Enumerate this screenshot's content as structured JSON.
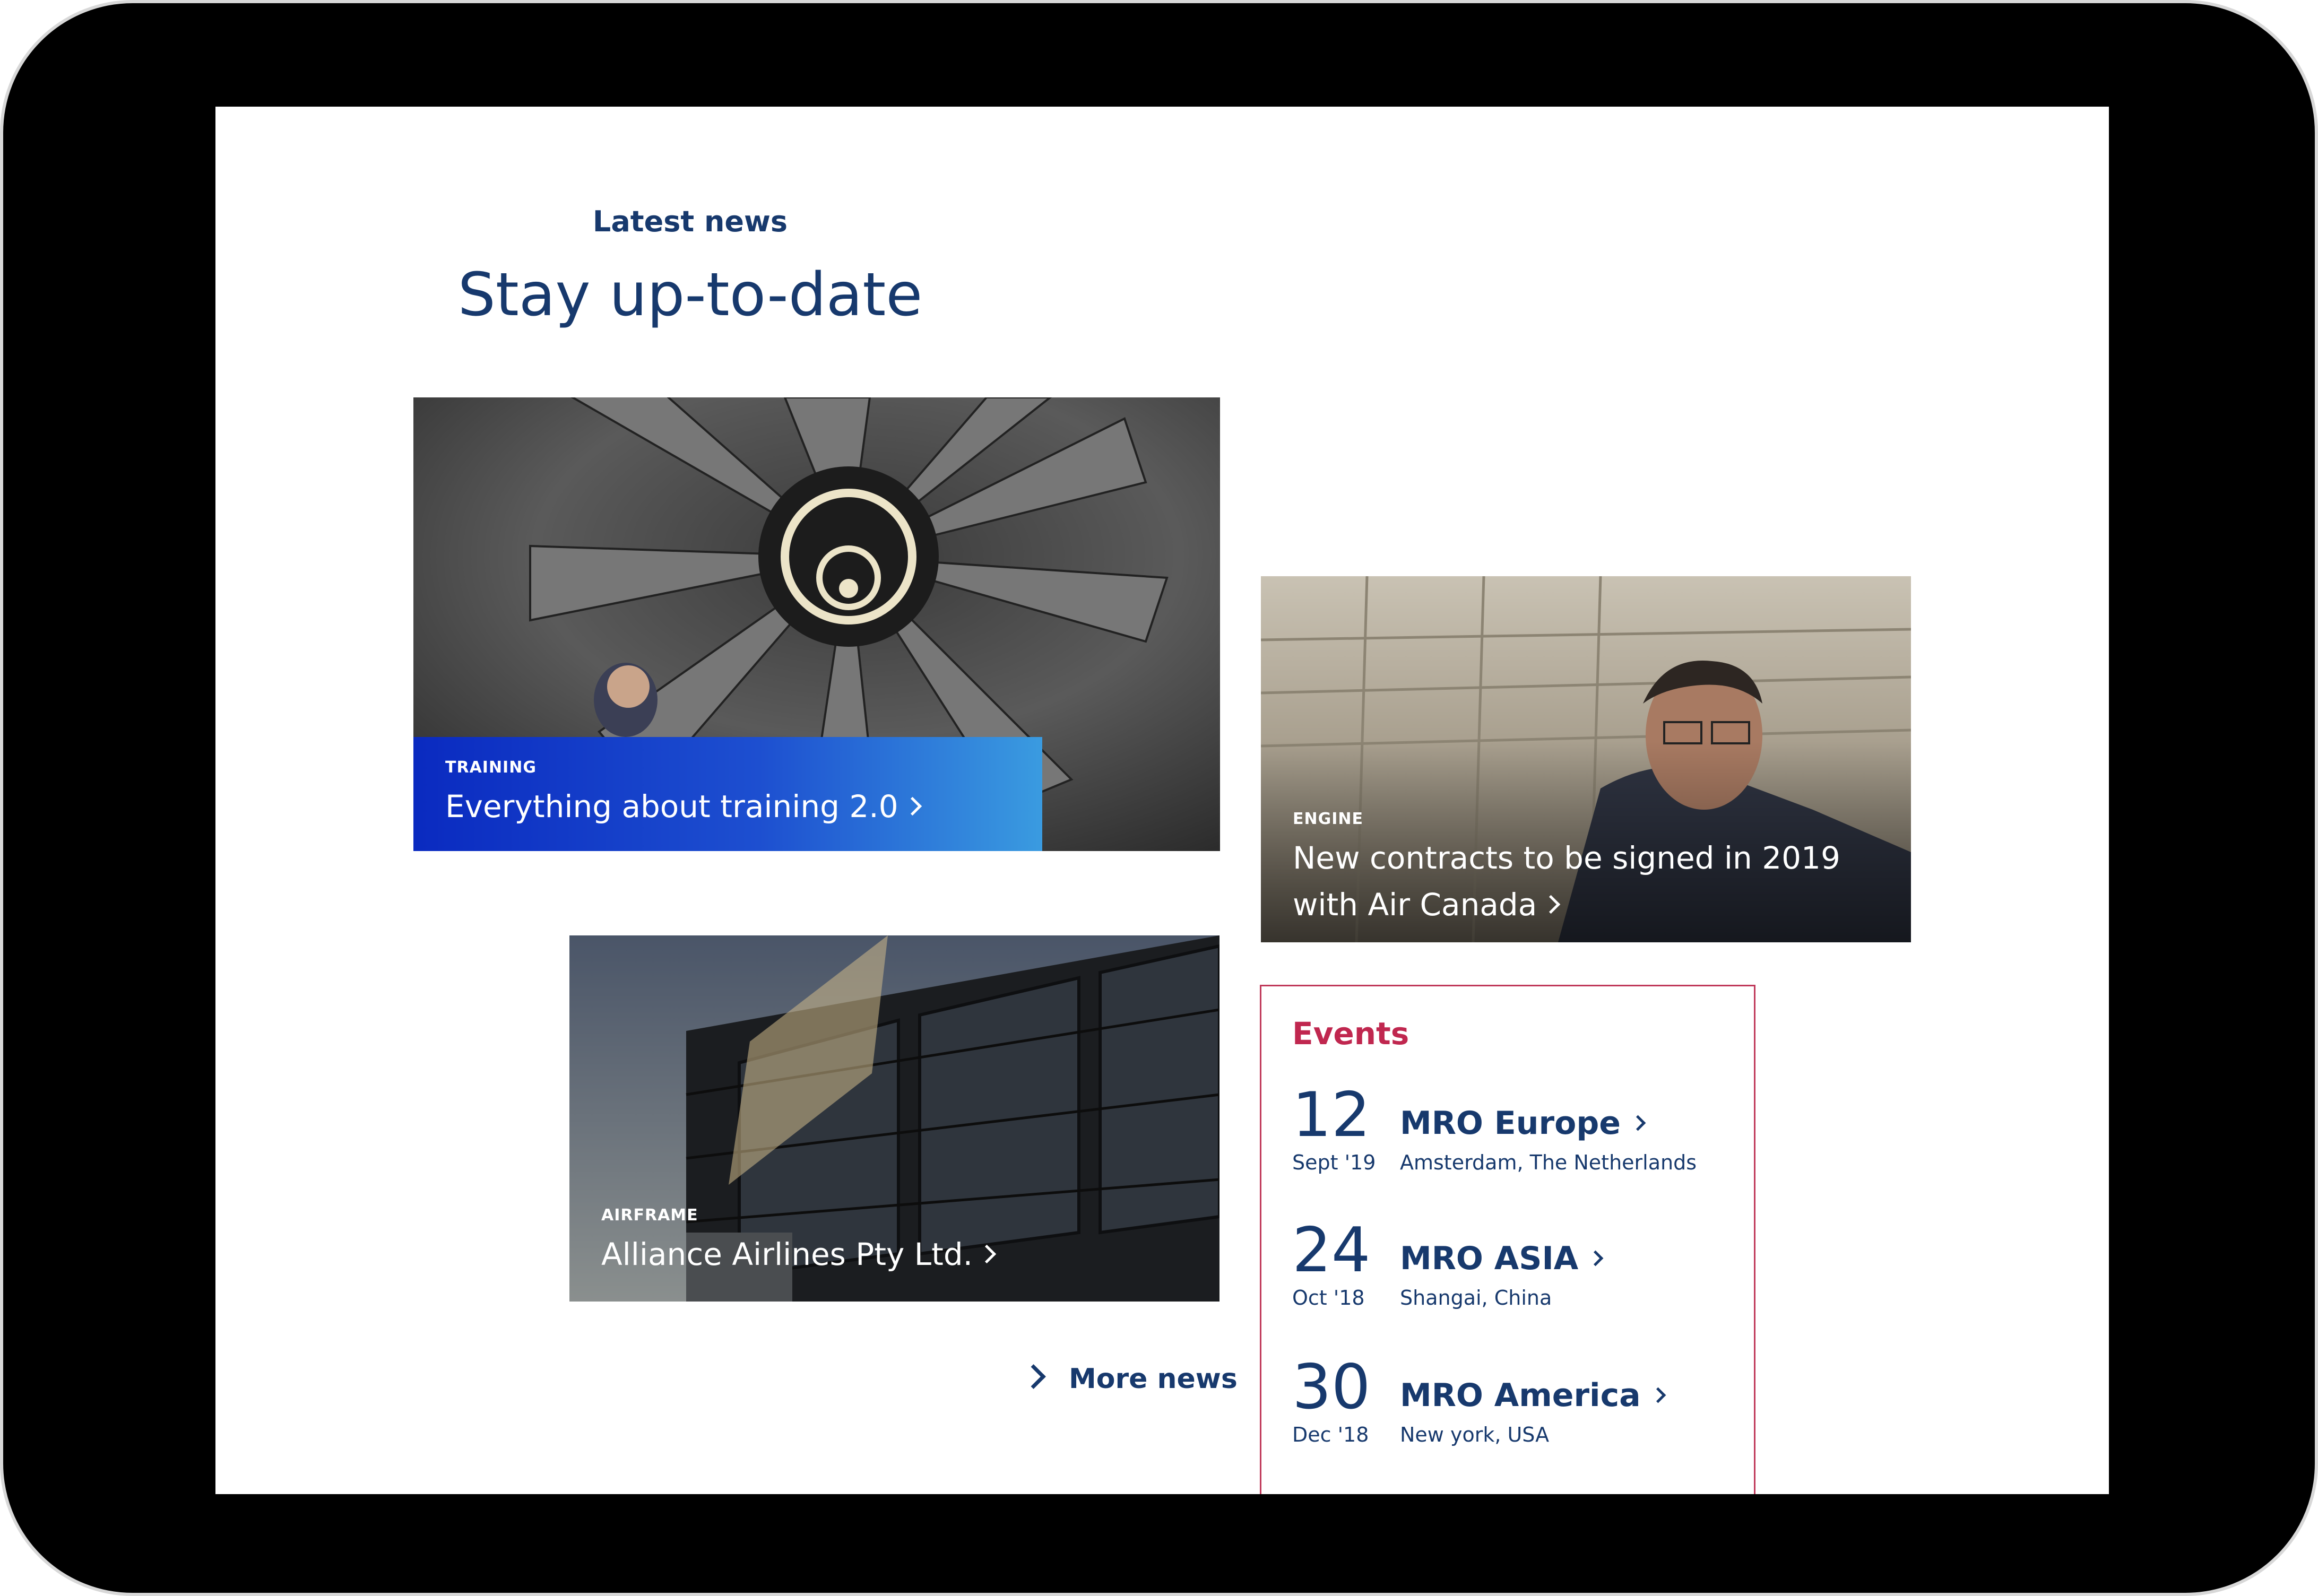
{
  "header": {
    "eyebrow": "Latest news",
    "title": "Stay up-to-date"
  },
  "news": [
    {
      "category": "TRAINING",
      "headline": "Everything about training 2.0"
    },
    {
      "category": "ENGINE",
      "headline_line1": "New contracts to be signed in 2019",
      "headline_line2": "with Air Canada"
    },
    {
      "category": "AIRFRAME",
      "headline": "Alliance Airlines Pty Ltd."
    }
  ],
  "more_news_label": "More news",
  "events": {
    "title": "Events",
    "items": [
      {
        "day": "12",
        "month": "Sept '19",
        "name": "MRO Europe",
        "place": "Amsterdam, The Netherlands"
      },
      {
        "day": "24",
        "month": "Oct '18",
        "name": "MRO ASIA",
        "place": "Shangai, China"
      },
      {
        "day": "30",
        "month": "Dec '18",
        "name": "MRO America",
        "place": "New york, USA"
      }
    ]
  },
  "colors": {
    "navy": "#17396d",
    "event_accent": "#c0274f",
    "training_banner_start": "#0a2ac0",
    "training_banner_end": "#3a9be0"
  }
}
